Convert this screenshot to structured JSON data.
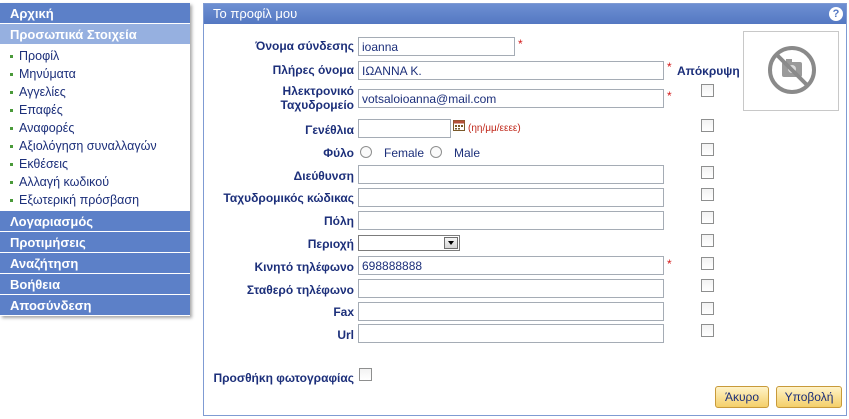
{
  "sidebar": {
    "home": "Αρχική",
    "personal": "Προσωπικά Στοιχεία",
    "sub_items": [
      "Προφίλ",
      "Μηνύματα",
      "Αγγελίες",
      "Επαφές",
      "Αναφορές",
      "Αξιολόγηση συναλλαγών",
      "Εκθέσεις",
      "Αλλαγή κωδικού",
      "Εξωτερική πρόσβαση"
    ],
    "account": "Λογαριασμός",
    "preferences": "Προτιμήσεις",
    "search": "Αναζήτηση",
    "help": "Βοήθεια",
    "logout": "Αποσύνδεση"
  },
  "panel": {
    "title": "Το προφίλ μου",
    "help_icon": "?"
  },
  "form": {
    "hide_header": "Απόκρυψη",
    "required_mark": "*",
    "username": {
      "label": "Όνομα σύνδεσης",
      "value": "ioanna"
    },
    "fullname": {
      "label": "Πλήρες όνομα",
      "value": "ΙΩΑΝΝΑ Κ."
    },
    "email": {
      "label_line1": "Ηλεκτρονικό",
      "label_line2": "Ταχυδρομείο",
      "value": "votsaloioanna@mail.com"
    },
    "birthday": {
      "label": "Γενέθλια",
      "value": "",
      "hint": "(ηη/μμ/εεεε)"
    },
    "gender": {
      "label": "Φύλο",
      "female": "Female",
      "male": "Male"
    },
    "address": {
      "label": "Διεύθυνση",
      "value": ""
    },
    "postal": {
      "label": "Ταχυδρομικός κώδικας",
      "value": ""
    },
    "city": {
      "label": "Πόλη",
      "value": ""
    },
    "region": {
      "label": "Περιοχή",
      "value": ""
    },
    "mobile": {
      "label": "Κινητό τηλέφωνο",
      "value": "698888888"
    },
    "landline": {
      "label": "Σταθερό τηλέφωνο",
      "value": ""
    },
    "fax": {
      "label": "Fax",
      "value": ""
    },
    "url": {
      "label": "Url",
      "value": ""
    },
    "add_photo": {
      "label": "Προσθήκη φωτογραφίας"
    }
  },
  "buttons": {
    "cancel": "Άκυρο",
    "submit": "Υποβολή"
  },
  "colors": {
    "nav_bg": "#5c80c8",
    "nav_active": "#96b0e0",
    "label_text": "#1c2f7a",
    "required": "#d31a1a",
    "button_bg": "#f4cf6a"
  },
  "icons": {
    "help": "help-icon",
    "calendar": "calendar-icon",
    "photo_placeholder": "no-photo-icon",
    "select_arrow": "chevron-down-icon"
  }
}
